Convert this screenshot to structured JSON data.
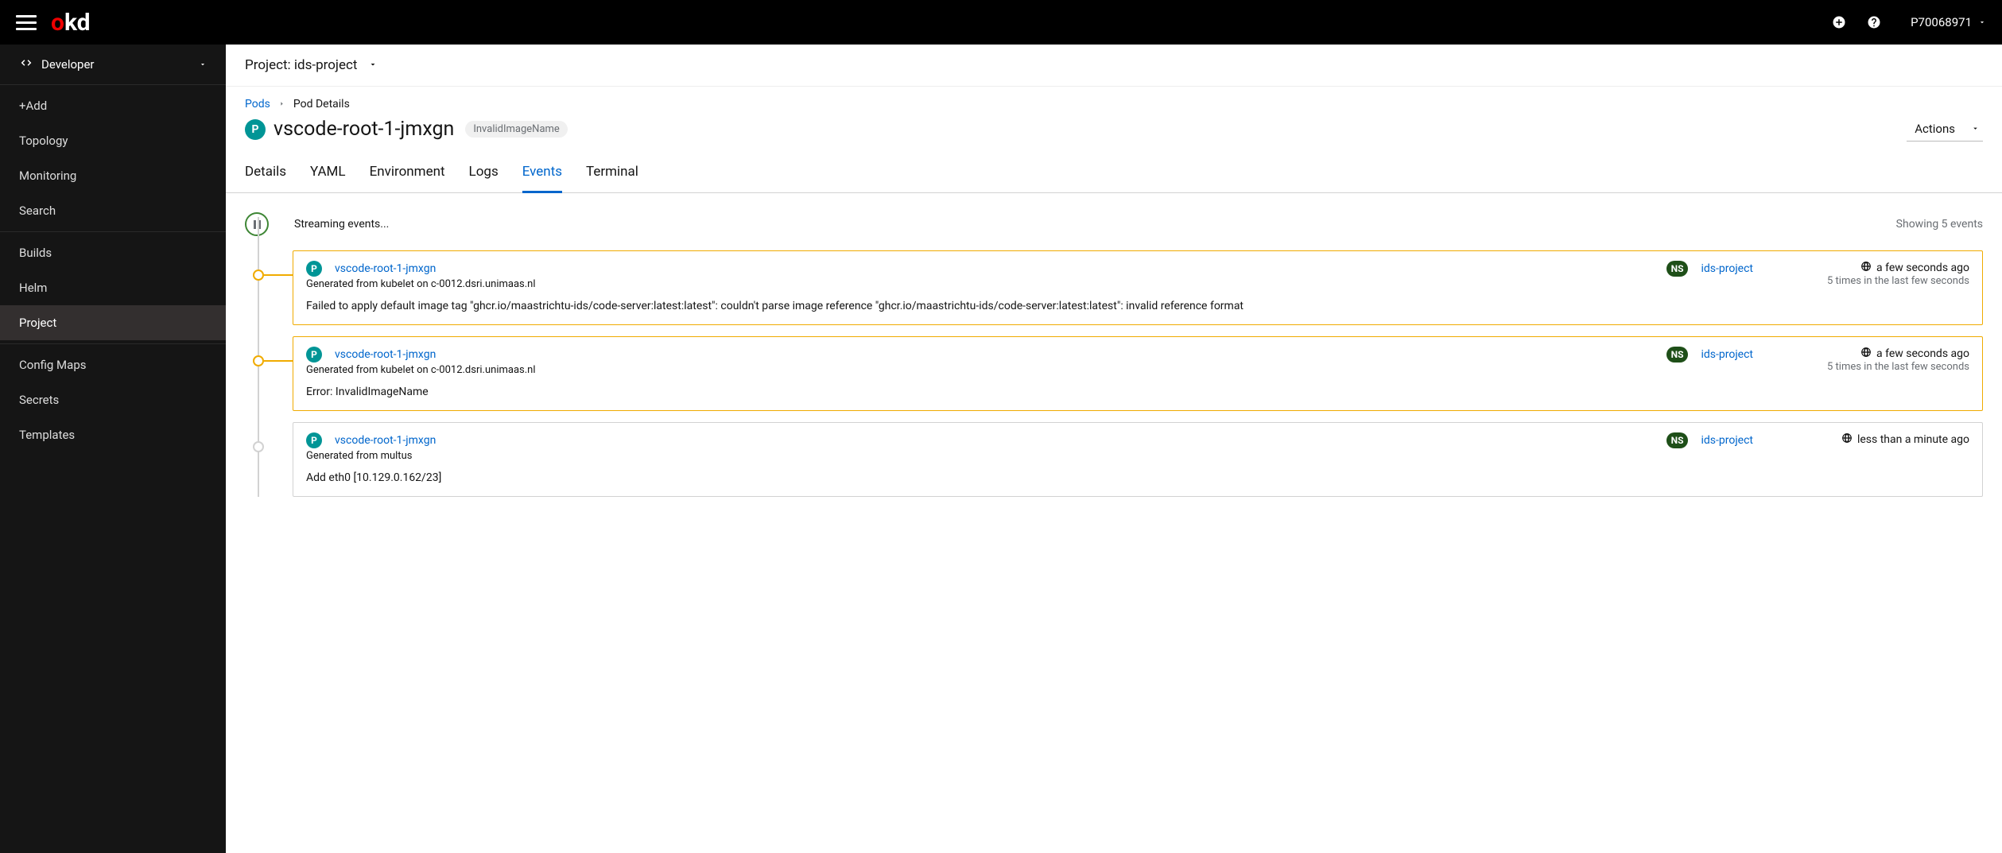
{
  "topbar": {
    "logo_o": "o",
    "logo_kd": "kd",
    "user": "P70068971"
  },
  "sidebar": {
    "perspective": "Developer",
    "items": [
      {
        "label": "+Add",
        "active": false
      },
      {
        "label": "Topology",
        "active": false
      },
      {
        "label": "Monitoring",
        "active": false
      },
      {
        "label": "Search",
        "active": false
      }
    ],
    "items2": [
      {
        "label": "Builds",
        "active": false
      },
      {
        "label": "Helm",
        "active": false
      },
      {
        "label": "Project",
        "active": true
      }
    ],
    "items3": [
      {
        "label": "Config Maps",
        "active": false
      },
      {
        "label": "Secrets",
        "active": false
      },
      {
        "label": "Templates",
        "active": false
      }
    ]
  },
  "project_bar": {
    "label": "Project:",
    "name": "ids-project"
  },
  "breadcrumbs": {
    "root": "Pods",
    "current": "Pod Details"
  },
  "title": {
    "kind_letter": "P",
    "name": "vscode-root-1-jmxgn",
    "status": "InvalidImageName",
    "actions": "Actions"
  },
  "tabs": [
    {
      "label": "Details",
      "active": false
    },
    {
      "label": "YAML",
      "active": false
    },
    {
      "label": "Environment",
      "active": false
    },
    {
      "label": "Logs",
      "active": false
    },
    {
      "label": "Events",
      "active": true
    },
    {
      "label": "Terminal",
      "active": false
    }
  ],
  "stream": {
    "label": "Streaming events...",
    "count": "Showing 5 events"
  },
  "events": [
    {
      "severity": "warning",
      "pod_kind": "P",
      "pod": "vscode-root-1-jmxgn",
      "ns_kind": "NS",
      "ns": "ids-project",
      "time": "a few seconds ago",
      "count": "5 times in the last few seconds",
      "source": "Generated from kubelet on c-0012.dsri.unimaas.nl",
      "message": "Failed to apply default image tag \"ghcr.io/maastrichtu-ids/code-server:latest:latest\": couldn't parse image reference \"ghcr.io/maastrichtu-ids/code-server:latest:latest\": invalid reference format"
    },
    {
      "severity": "warning",
      "pod_kind": "P",
      "pod": "vscode-root-1-jmxgn",
      "ns_kind": "NS",
      "ns": "ids-project",
      "time": "a few seconds ago",
      "count": "5 times in the last few seconds",
      "source": "Generated from kubelet on c-0012.dsri.unimaas.nl",
      "message": "Error: InvalidImageName"
    },
    {
      "severity": "info",
      "pod_kind": "P",
      "pod": "vscode-root-1-jmxgn",
      "ns_kind": "NS",
      "ns": "ids-project",
      "time": "less than a minute ago",
      "count": "",
      "source": "Generated from multus",
      "message": "Add eth0 [10.129.0.162/23]"
    }
  ]
}
